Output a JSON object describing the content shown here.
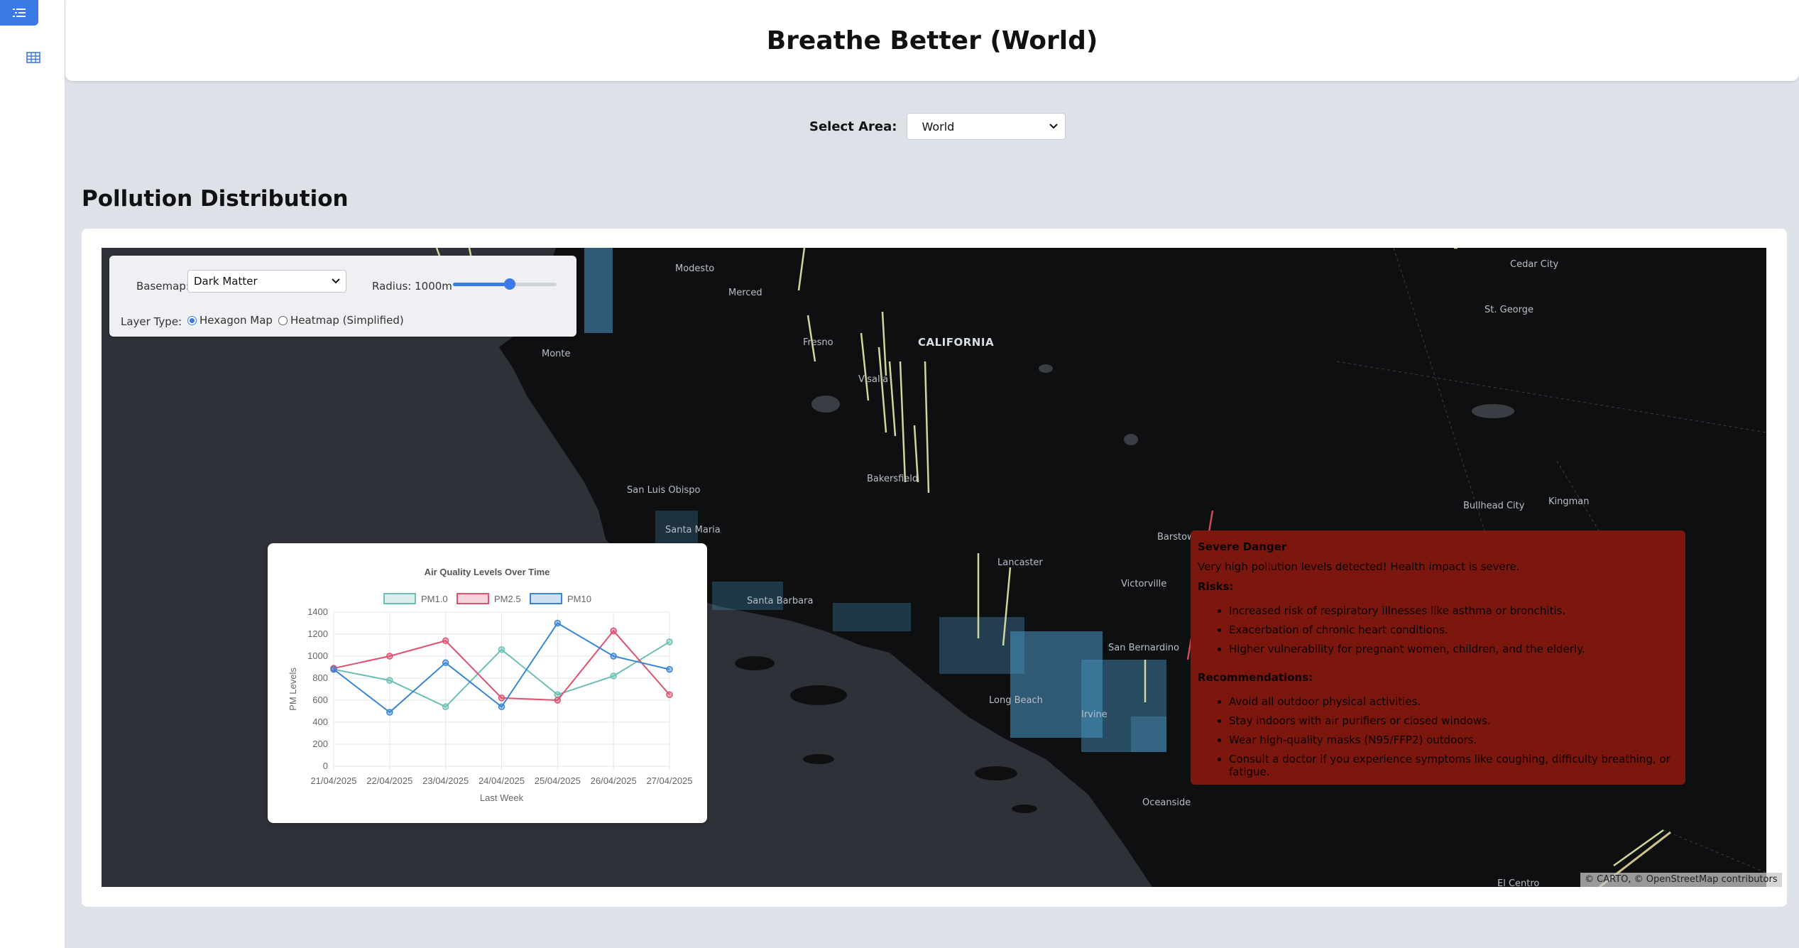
{
  "sidebar": {
    "menu_icon": "menu-icon",
    "grid_icon": "table-grid-icon"
  },
  "header": {
    "title": "Breathe Better (World)"
  },
  "area_select": {
    "label": "Select Area:",
    "value": "World"
  },
  "section": {
    "title": "Pollution Distribution"
  },
  "controls": {
    "basemap_label": "Basemap:",
    "basemap_value": "Dark Matter",
    "radius_label": "Radius: 1000m",
    "radius_fraction": 0.55,
    "layer_type_label": "Layer Type:",
    "layer_options": [
      "Hexagon Map",
      "Heatmap (Simplified)"
    ],
    "layer_selected": "Hexagon Map"
  },
  "map": {
    "labels": [
      "Modesto",
      "Merced",
      "Fresno",
      "CALIFORNIA",
      "Visalia",
      "Monte",
      "Bakersfield",
      "San Luis Obispo",
      "Santa Maria",
      "Santa Barbara",
      "Lancaster",
      "Victorville",
      "Barstow",
      "San Bernardino",
      "Long Beach",
      "Irvine",
      "Oceanside",
      "Cedar City",
      "St. George",
      "Bullhead City",
      "Kingman",
      "El Centro"
    ],
    "attribution": "© CARTO, © OpenStreetMap contributors"
  },
  "chart_data": {
    "type": "line",
    "title": "Air Quality Levels Over Time",
    "xlabel": "Last Week",
    "ylabel": "PM Levels",
    "categories": [
      "21/04/2025",
      "22/04/2025",
      "23/04/2025",
      "24/04/2025",
      "25/04/2025",
      "26/04/2025",
      "27/04/2025"
    ],
    "ylim": [
      0,
      1400
    ],
    "yticks": [
      0,
      200,
      400,
      600,
      800,
      1000,
      1200,
      1400
    ],
    "legend_position": "top",
    "grid": true,
    "series": [
      {
        "name": "PM1.0",
        "color": "#6cbfb6",
        "values": [
          880,
          780,
          540,
          1060,
          650,
          820,
          1130
        ]
      },
      {
        "name": "PM2.5",
        "color": "#e0506f",
        "values": [
          890,
          1000,
          1140,
          620,
          600,
          1230,
          650
        ]
      },
      {
        "name": "PM10",
        "color": "#3a86d4",
        "values": [
          880,
          490,
          940,
          540,
          1300,
          1000,
          880
        ]
      }
    ]
  },
  "danger": {
    "title": "Severe Danger",
    "message": "Very high pollution levels detected! Health impact is severe.",
    "risks_heading": "Risks:",
    "risks": [
      "Increased risk of respiratory illnesses like asthma or bronchitis.",
      "Exacerbation of chronic heart conditions.",
      "Higher vulnerability for pregnant women, children, and the elderly."
    ],
    "recommendations_heading": "Recommendations:",
    "recommendations": [
      "Avoid all outdoor physical activities.",
      "Stay indoors with air purifiers or closed windows.",
      "Wear high-quality masks (N95/FFP2) outdoors.",
      "Consult a doctor if you experience symptoms like coughing, difficulty breathing, or fatigue."
    ],
    "bg_color": "#7c170d"
  }
}
